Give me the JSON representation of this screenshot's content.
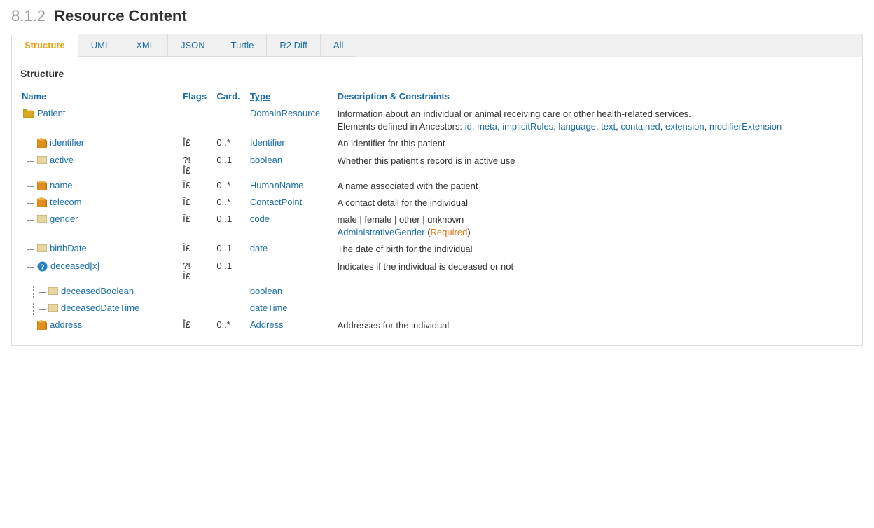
{
  "page": {
    "title_prefix": "8.1.2",
    "title": "Resource Content"
  },
  "tabs": [
    {
      "id": "structure",
      "label": "Structure",
      "active": true
    },
    {
      "id": "uml",
      "label": "UML",
      "active": false
    },
    {
      "id": "xml",
      "label": "XML",
      "active": false
    },
    {
      "id": "json",
      "label": "JSON",
      "active": false
    },
    {
      "id": "turtle",
      "label": "Turtle",
      "active": false
    },
    {
      "id": "r2diff",
      "label": "R2 Diff",
      "active": false
    },
    {
      "id": "all",
      "label": "All",
      "active": false
    }
  ],
  "structure": {
    "heading": "Structure",
    "columns": {
      "name": "Name",
      "flags": "Flags",
      "card": "Card.",
      "type": "Type",
      "desc": "Description & Constraints"
    },
    "rows": [
      {
        "id": "patient",
        "indent": 0,
        "icon": "folder",
        "name": "Patient",
        "flags": "",
        "card": "",
        "type": "DomainResource",
        "type_link": true,
        "desc": "Information about an individual or animal receiving care or other health-related services.",
        "desc_extra": "Elements defined in Ancestors: id, meta, implicitRules, language, text, contained, extension, modifierExtension",
        "desc_links": [
          "id",
          "meta",
          "implicitRules",
          "language",
          "text",
          "contained",
          "extension",
          "modifierExtension"
        ]
      },
      {
        "id": "identifier",
        "indent": 1,
        "icon": "cube",
        "name": "identifier",
        "flags": "Î£",
        "card": "0..*",
        "type": "Identifier",
        "type_link": true,
        "desc": "An identifier for this patient"
      },
      {
        "id": "active",
        "indent": 1,
        "icon": "rect",
        "name": "active",
        "flags": "?!\nÎ£",
        "card": "0..1",
        "type": "boolean",
        "type_link": true,
        "desc": "Whether this patient's record is in active use"
      },
      {
        "id": "name",
        "indent": 1,
        "icon": "cube",
        "name": "name",
        "flags": "Î£",
        "card": "0..*",
        "type": "HumanName",
        "type_link": true,
        "desc": "A name associated with the patient"
      },
      {
        "id": "telecom",
        "indent": 1,
        "icon": "cube",
        "name": "telecom",
        "flags": "Î£",
        "card": "0..*",
        "type": "ContactPoint",
        "type_link": true,
        "desc": "A contact detail for the individual"
      },
      {
        "id": "gender",
        "indent": 1,
        "icon": "rect",
        "name": "gender",
        "flags": "Î£",
        "card": "0..1",
        "type": "code",
        "type_link": true,
        "desc": "male | female | other | unknown",
        "desc_extra2": "AdministrativeGender (Required)"
      },
      {
        "id": "birthDate",
        "indent": 1,
        "icon": "rect",
        "name": "birthDate",
        "flags": "Î£",
        "card": "0..1",
        "type": "date",
        "type_link": true,
        "desc": "The date of birth for the individual"
      },
      {
        "id": "deceased",
        "indent": 1,
        "icon": "question",
        "name": "deceased[x]",
        "flags": "?!\nÎ£",
        "card": "0..1",
        "type": "",
        "type_link": false,
        "desc": "Indicates if the individual is deceased or not"
      },
      {
        "id": "deceasedBoolean",
        "indent": 2,
        "icon": "rect",
        "name": "deceasedBoolean",
        "flags": "",
        "card": "",
        "type": "boolean",
        "type_link": true,
        "desc": ""
      },
      {
        "id": "deceasedDateTime",
        "indent": 2,
        "icon": "rect",
        "name": "deceasedDateTime",
        "flags": "",
        "card": "",
        "type": "dateTime",
        "type_link": true,
        "desc": ""
      },
      {
        "id": "address",
        "indent": 1,
        "icon": "cube",
        "name": "address",
        "flags": "Î£",
        "card": "0..*",
        "type": "Address",
        "type_link": true,
        "desc": "Addresses for the individual"
      }
    ]
  }
}
